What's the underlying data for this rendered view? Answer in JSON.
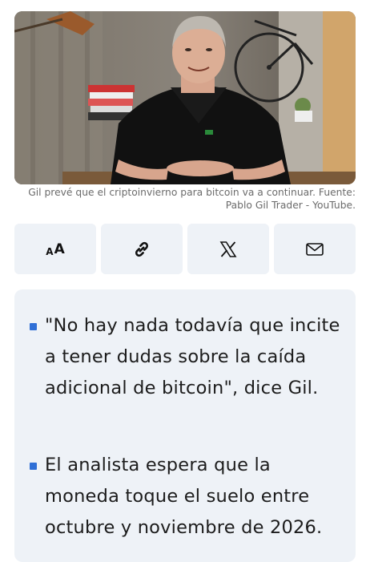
{
  "hero_image": {
    "alt": "Man in black polo shirt speaking to camera, bicycle and bookshelf behind"
  },
  "caption": {
    "text": "Gil prevé que el criptoinvierno para bitcoin va a continuar. Fuente: Pablo Gil Trader - YouTube."
  },
  "share": {
    "text_size_small": "A",
    "text_size_big": "A",
    "icons": [
      "text-size-icon",
      "link-icon",
      "x-logo-icon",
      "mail-icon"
    ]
  },
  "summary": {
    "items": [
      {
        "text": "\"No hay nada todavía que incite a tener dudas sobre la caída adicional de bitcoin\", dice Gil."
      },
      {
        "text": "El analista espera que la moneda toque el suelo entre octubre y noviembre de 2026."
      }
    ]
  },
  "colors": {
    "bullet": "#2f6fd6",
    "panel": "#eef2f7",
    "caption": "#6b6b6b"
  }
}
